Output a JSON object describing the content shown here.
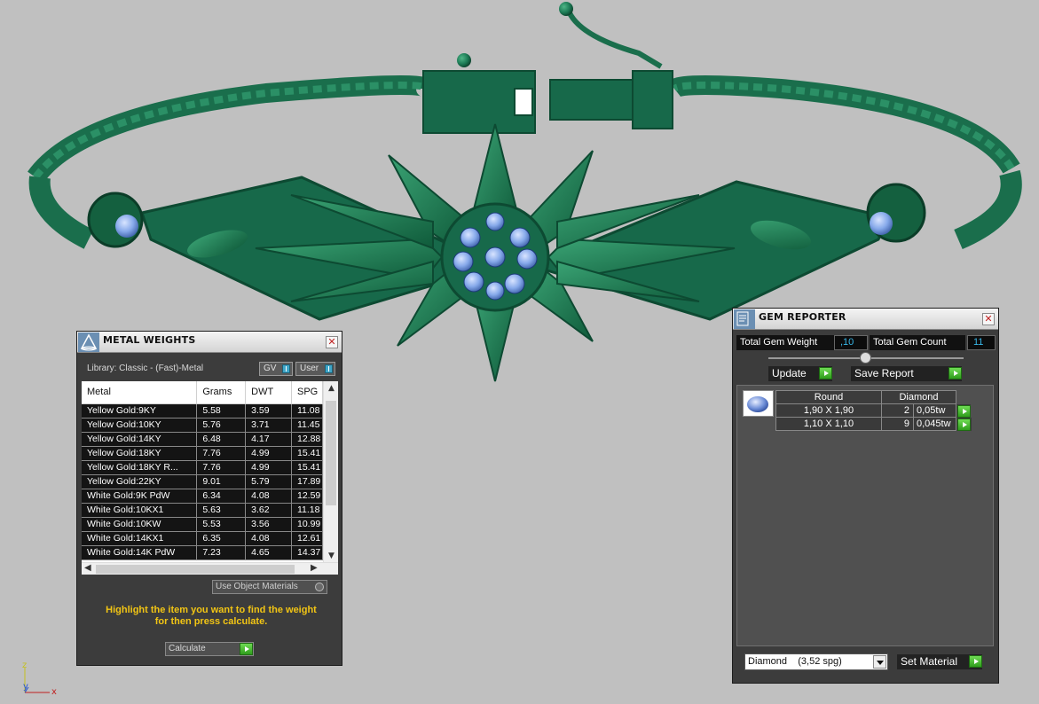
{
  "metal_panel": {
    "title": "METAL WEIGHTS",
    "library": "Library: Classic - (Fast)-Metal",
    "gv_label": "GV",
    "user_label": "User",
    "columns": [
      "Metal",
      "Grams",
      "DWT",
      "SPG"
    ],
    "rows": [
      [
        "Yellow Gold:9KY",
        "5.58",
        "3.59",
        "11.08"
      ],
      [
        "Yellow Gold:10KY",
        "5.76",
        "3.71",
        "11.45"
      ],
      [
        "Yellow Gold:14KY",
        "6.48",
        "4.17",
        "12.88"
      ],
      [
        "Yellow Gold:18KY",
        "7.76",
        "4.99",
        "15.41"
      ],
      [
        "Yellow Gold:18KY R...",
        "7.76",
        "4.99",
        "15.41"
      ],
      [
        "Yellow Gold:22KY",
        "9.01",
        "5.79",
        "17.89"
      ],
      [
        "White Gold:9K PdW",
        "6.34",
        "4.08",
        "12.59"
      ],
      [
        "White Gold:10KX1",
        "5.63",
        "3.62",
        "11.18"
      ],
      [
        "White Gold:10KW",
        "5.53",
        "3.56",
        "10.99"
      ],
      [
        "White Gold:14KX1",
        "6.35",
        "4.08",
        "12.61"
      ],
      [
        "White Gold:14K PdW",
        "7.23",
        "4.65",
        "14.37"
      ]
    ],
    "use_object_materials": "Use Object Materials",
    "hint_line1": "Highlight the item you want to find the weight",
    "hint_line2": "for then press calculate.",
    "calculate_label": "Calculate"
  },
  "gem_panel": {
    "title": "GEM REPORTER",
    "total_gem_weight_label": "Total Gem Weight",
    "total_gem_weight_value": ",10",
    "total_gem_count_label": "Total Gem Count",
    "total_gem_count_value": "11",
    "update_label": "Update",
    "save_report_label": "Save Report",
    "shape_header": "Round",
    "material_header": "Diamond",
    "gems": [
      {
        "size": "1,90 X 1,90",
        "count": "2",
        "weight": "0,05tw"
      },
      {
        "size": "1,10 X 1,10",
        "count": "9",
        "weight": "0,045tw"
      }
    ],
    "material_select": "Diamond    (3,52 spg)",
    "set_material_label": "Set Material"
  },
  "axis": {
    "z": "z",
    "y": "y",
    "x": "x"
  },
  "colors": {
    "metal": "#1c7a55",
    "metal_dark": "#0f4d33",
    "gem": "#86a9ea",
    "background": "#c0c0c0",
    "hint_yellow": "#f2c514",
    "value_blue": "#37b7e8"
  }
}
